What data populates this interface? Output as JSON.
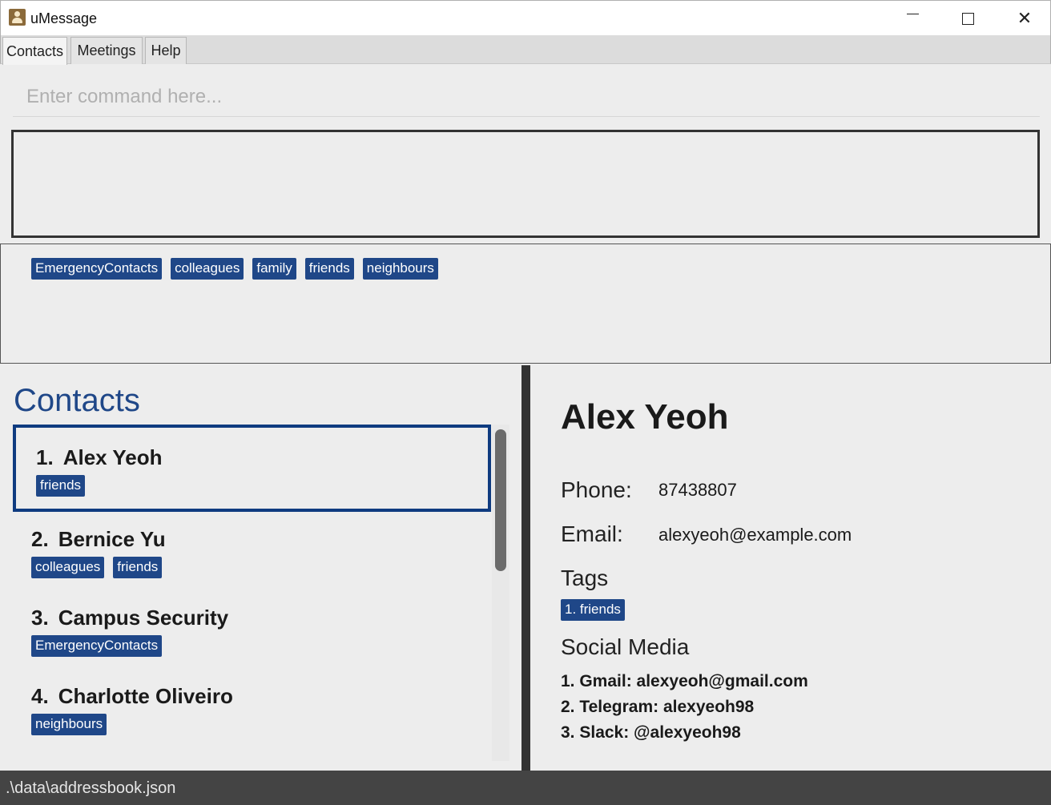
{
  "window": {
    "title": "uMessage",
    "minimize_label": "",
    "maximize_label": "",
    "close_label": "✕"
  },
  "tabs": [
    {
      "label": "Contacts",
      "active": true
    },
    {
      "label": "Meetings",
      "active": false
    },
    {
      "label": "Help",
      "active": false
    }
  ],
  "command": {
    "placeholder": "Enter command here...",
    "value": ""
  },
  "result": {
    "text": ""
  },
  "all_tags": [
    "EmergencyContacts",
    "colleagues",
    "family",
    "friends",
    "neighbours"
  ],
  "contacts_panel": {
    "title": "Contacts",
    "contacts": [
      {
        "index": "1.",
        "name": "Alex Yeoh",
        "tags": [
          "friends"
        ],
        "selected": true
      },
      {
        "index": "2.",
        "name": "Bernice Yu",
        "tags": [
          "colleagues",
          "friends"
        ],
        "selected": false
      },
      {
        "index": "3.",
        "name": "Campus Security",
        "tags": [
          "EmergencyContacts"
        ],
        "selected": false
      },
      {
        "index": "4.",
        "name": "Charlotte Oliveiro",
        "tags": [
          "neighbours"
        ],
        "selected": false
      }
    ]
  },
  "detail": {
    "name": "Alex Yeoh",
    "phone_label": "Phone:",
    "phone": "87438807",
    "email_label": "Email:",
    "email": "alexyeoh@example.com",
    "tags_label": "Tags",
    "tags": [
      "1. friends"
    ],
    "social_label": "Social Media",
    "social": [
      "1. Gmail: alexyeoh@gmail.com",
      "2. Telegram: alexyeoh98",
      "3. Slack: @alexyeoh98"
    ]
  },
  "status": {
    "path": ".\\data\\addressbook.json"
  },
  "colors": {
    "tag_bg": "#1f4788",
    "accent": "#0f3b80",
    "status_bg": "#444444"
  }
}
